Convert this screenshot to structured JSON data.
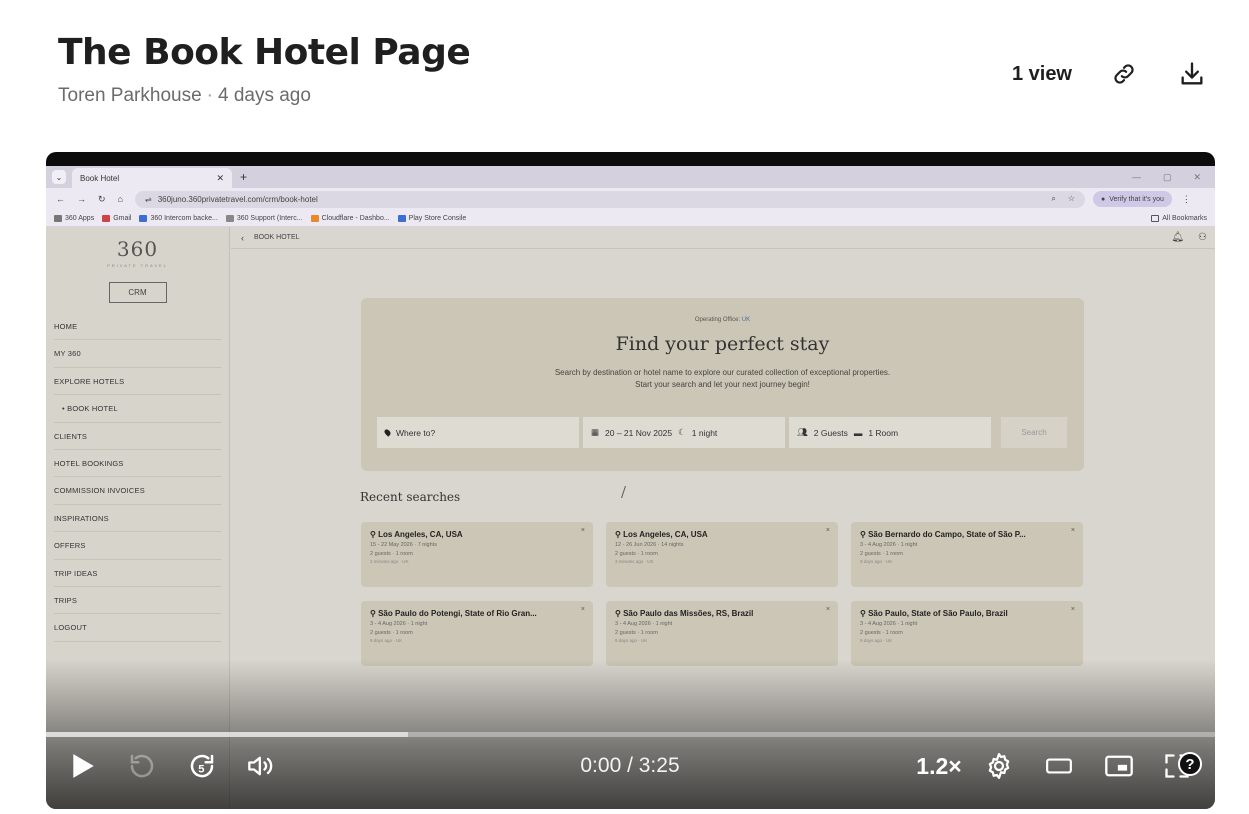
{
  "page": {
    "title": "The Book Hotel Page",
    "author": "Toren Parkhouse",
    "age": "4 days ago",
    "views": "1 view"
  },
  "player": {
    "time": "0:00 / 3:25",
    "speed": "1.2×",
    "progress_buffered_fraction": 0.31
  },
  "browser": {
    "tab_title": "Book Hotel",
    "url": "360juno.360privatetravel.com/crm/book-hotel",
    "verify_label": "Verify that it's you",
    "bookmarks": [
      "360 Apps",
      "Gmail",
      "360 Intercom backe...",
      "360 Support (Interc...",
      "Cloudflare - Dashbo...",
      "Play Store Consile"
    ],
    "all_bookmarks": "All Bookmarks"
  },
  "app": {
    "logo": "360",
    "logo_sub": "PRIVATE TRAVEL",
    "crm_button": "CRM",
    "breadcrumb": "BOOK HOTEL",
    "menu": [
      "HOME",
      "MY 360",
      "EXPLORE HOTELS",
      "BOOK HOTEL",
      "CLIENTS",
      "HOTEL BOOKINGS",
      "COMMISSION INVOICES",
      "INSPIRATIONS",
      "OFFERS",
      "TRIP IDEAS",
      "TRIPS",
      "LOGOUT"
    ],
    "operating_office_label": "Operating Office:",
    "operating_office_value": "UK",
    "heading": "Find your perfect stay",
    "desc_line1": "Search by destination or hotel name to explore our curated collection of exceptional properties.",
    "desc_line2": "Start your search and let your next journey begin!",
    "where_placeholder": "Where to?",
    "dates": "20 – 21 Nov 2025",
    "nights": "1 night",
    "guests": "2 Guests",
    "rooms": "1 Room",
    "search_button": "Search",
    "recent_title": "Recent searches",
    "recent": [
      {
        "loc": "Los Angeles, CA, USA",
        "dates": "15 - 22 May 2026 · 7 nights",
        "guests": "2 guests · 1 room",
        "ago": "2 minutes ago · UK"
      },
      {
        "loc": "Los Angeles, CA, USA",
        "dates": "12 - 26 Jun 2026 · 14 nights",
        "guests": "2 guests · 1 room",
        "ago": "3 minutes ago · UK"
      },
      {
        "loc": "São Bernardo do Campo, State of São P...",
        "dates": "3 - 4 Aug 2026 · 1 night",
        "guests": "2 guests · 1 room",
        "ago": "9 days ago · UK"
      },
      {
        "loc": "São Paulo do Potengi, State of Rio Gran...",
        "dates": "3 - 4 Aug 2026 · 1 night",
        "guests": "2 guests · 1 room",
        "ago": "9 days ago · UK"
      },
      {
        "loc": "São Paulo das Missões, RS, Brazil",
        "dates": "3 - 4 Aug 2026 · 1 night",
        "guests": "2 guests · 1 room",
        "ago": "9 days ago · UK"
      },
      {
        "loc": "São Paulo, State of São Paulo, Brazil",
        "dates": "3 - 4 Aug 2026 · 1 night",
        "guests": "2 guests · 1 room",
        "ago": "9 days ago · UK"
      }
    ]
  }
}
